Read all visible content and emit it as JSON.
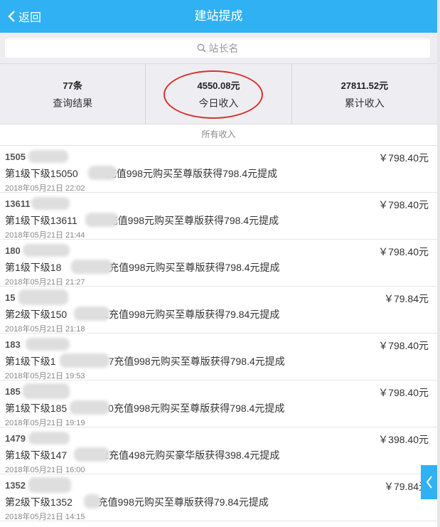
{
  "header": {
    "back_label": "返回",
    "title": "建站提成"
  },
  "search": {
    "placeholder": "站长名"
  },
  "stats": [
    {
      "value": "77条",
      "label": "查询结果"
    },
    {
      "value": "4550.08元",
      "label": "今日收入"
    },
    {
      "value": "27811.52元",
      "label": "累计收入"
    }
  ],
  "section_title": "所有收入",
  "items": [
    {
      "name": "1505",
      "amount": "￥798.40元",
      "desc_a": "第1级下级15050",
      "desc_b": "充值998元购买至尊版获得798.4元提成",
      "time": "2018年05月21日 22:02"
    },
    {
      "name": "13611",
      "amount": "￥798.40元",
      "desc_a": "第1级下级13611",
      "desc_b": "充值998元购买至尊版获得798.4元提成",
      "time": "2018年05月21日 21:44"
    },
    {
      "name": "180",
      "amount": "￥798.40元",
      "desc_a": "第1级下级18",
      "desc_b": "9充值998元购买至尊版获得798.4元提成",
      "time": "2018年05月21日 21:27"
    },
    {
      "name": "15",
      "amount": "￥79.84元",
      "desc_a": "第2级下级150",
      "desc_b": "1充值998元购买至尊版获得79.84元提成",
      "time": "2018年05月21日 21:18"
    },
    {
      "name": "183",
      "amount": "￥798.40元",
      "desc_a": "第1级下级1",
      "desc_b": "7充值998元购买至尊版获得798.4元提成",
      "time": "2018年05月21日 19:53"
    },
    {
      "name": "185",
      "amount": "￥798.40元",
      "desc_a": "第1级下级185",
      "desc_b": "0充值998元购买至尊版获得798.4元提成",
      "time": "2018年05月21日 19:19"
    },
    {
      "name": "1479",
      "amount": "￥398.40元",
      "desc_a": "第1级下级147",
      "desc_b": "2充值498元购买豪华版获得398.4元提成",
      "time": "2018年05月21日 16:00"
    },
    {
      "name": "1352",
      "amount": "￥79.84元",
      "desc_a": "第2级下级1352",
      "desc_b": "17充值998元购买至尊版获得79.84元提成",
      "time": "2018年05月21日 14:15"
    }
  ]
}
